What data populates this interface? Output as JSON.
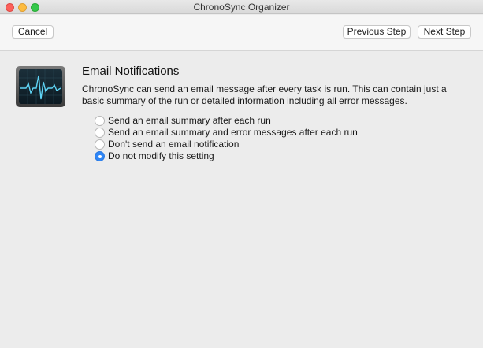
{
  "window": {
    "title": "ChronoSync Organizer"
  },
  "toolbar": {
    "cancel_label": "Cancel",
    "previous_label": "Previous Step",
    "next_label": "Next Step"
  },
  "content": {
    "icon": "activity-monitor-icon",
    "heading": "Email Notifications",
    "description": "ChronoSync can send an email message after every task is run. This can contain just a basic summary of the run or detailed information including all error messages.",
    "options": [
      {
        "label": "Send an email summary after each run",
        "selected": false
      },
      {
        "label": "Send an email summary and error messages after each run",
        "selected": false
      },
      {
        "label": "Don't send an email notification",
        "selected": false
      },
      {
        "label": "Do not modify this setting",
        "selected": true
      }
    ]
  },
  "colors": {
    "accent": "#2f86f6",
    "close": "#fc605b",
    "minimize": "#fdbc40",
    "maximize": "#34c84a"
  }
}
